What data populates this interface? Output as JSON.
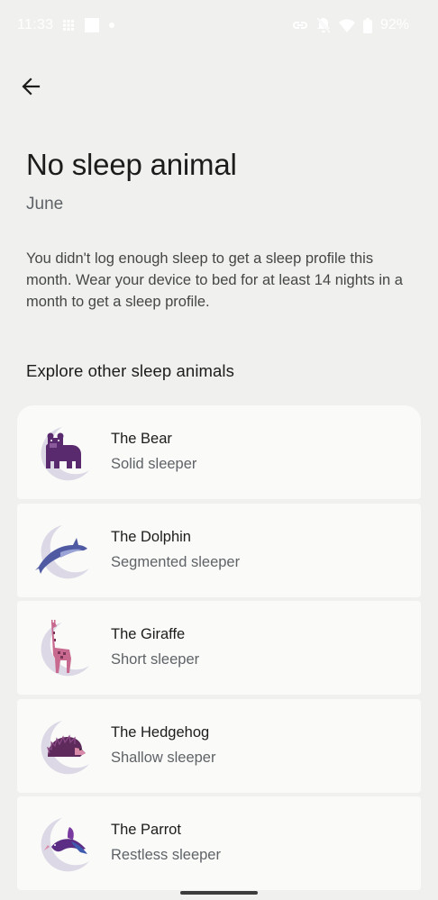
{
  "status_bar": {
    "time": "11:33",
    "battery": "92%",
    "left_icons": [
      "grid-icon",
      "square-icon",
      "dot-icon"
    ],
    "right_icons": [
      "link-icon",
      "notifications-off-icon",
      "wifi-icon",
      "battery-icon"
    ]
  },
  "header": {
    "title": "No sleep animal",
    "month": "June"
  },
  "description": "You didn't log enough sleep to get a sleep profile this month. Wear your device to bed for at least 14 nights in a month to get a sleep profile.",
  "explore": {
    "heading": "Explore other sleep animals",
    "animals": [
      {
        "name": "The Bear",
        "type": "Solid sleeper",
        "icon": "bear-icon"
      },
      {
        "name": "The Dolphin",
        "type": "Segmented sleeper",
        "icon": "dolphin-icon"
      },
      {
        "name": "The Giraffe",
        "type": "Short sleeper",
        "icon": "giraffe-icon"
      },
      {
        "name": "The Hedgehog",
        "type": "Shallow sleeper",
        "icon": "hedgehog-icon"
      },
      {
        "name": "The Parrot",
        "type": "Restless sleeper",
        "icon": "parrot-icon"
      }
    ]
  },
  "colors": {
    "background": "#f0f1ee",
    "card": "#fafbf8",
    "moon": "#dcd8e6",
    "bear": "#5a2a6e",
    "dolphin": "#4f5aa3",
    "giraffe": "#c86a8f",
    "hedgehog": "#5e2a5c",
    "parrot": "#5b2d84"
  }
}
